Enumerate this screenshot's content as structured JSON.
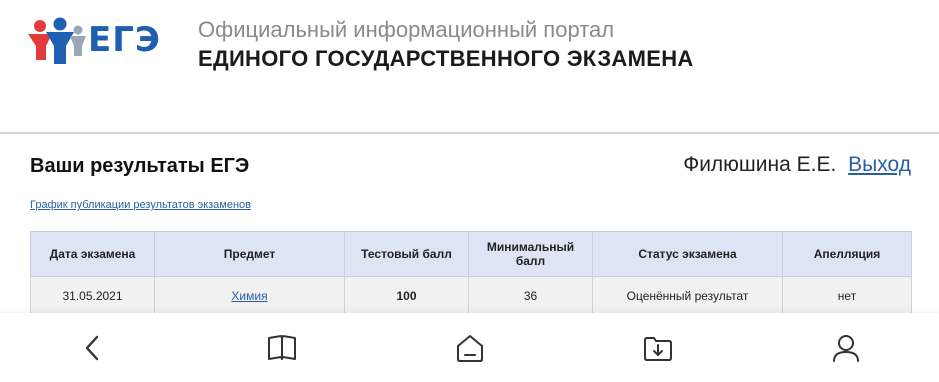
{
  "header": {
    "logo_text": "ЕГЭ",
    "portal_subtitle": "Официальный информационный портал",
    "portal_title": "ЕДИНОГО ГОСУДАРСТВЕННОГО ЭКЗАМЕНА"
  },
  "results": {
    "title": "Ваши результаты ЕГЭ",
    "user_name": "Филюшина Е.Е.",
    "logout_label": "Выход",
    "schedule_link": "График публикации результатов экзаменов",
    "columns": [
      "Дата экзамена",
      "Предмет",
      "Тестовый балл",
      "Минимальный балл",
      "Статус экзамена",
      "Апелляция"
    ],
    "rows": [
      {
        "date": "31.05.2021",
        "subject": "Химия",
        "score": "100",
        "min_score": "36",
        "status": "Оценённый результат",
        "appeal": "нет"
      }
    ]
  },
  "bottom_nav": {
    "items": [
      "back-icon",
      "book-icon",
      "home-icon",
      "download-folder-icon",
      "profile-icon"
    ]
  },
  "colors": {
    "link": "#2a5fa6",
    "score": "#1b8a1b",
    "table_header_bg": "#dde5f4",
    "logo_blue": "#1f5fb0",
    "logo_red": "#e23b3b"
  }
}
